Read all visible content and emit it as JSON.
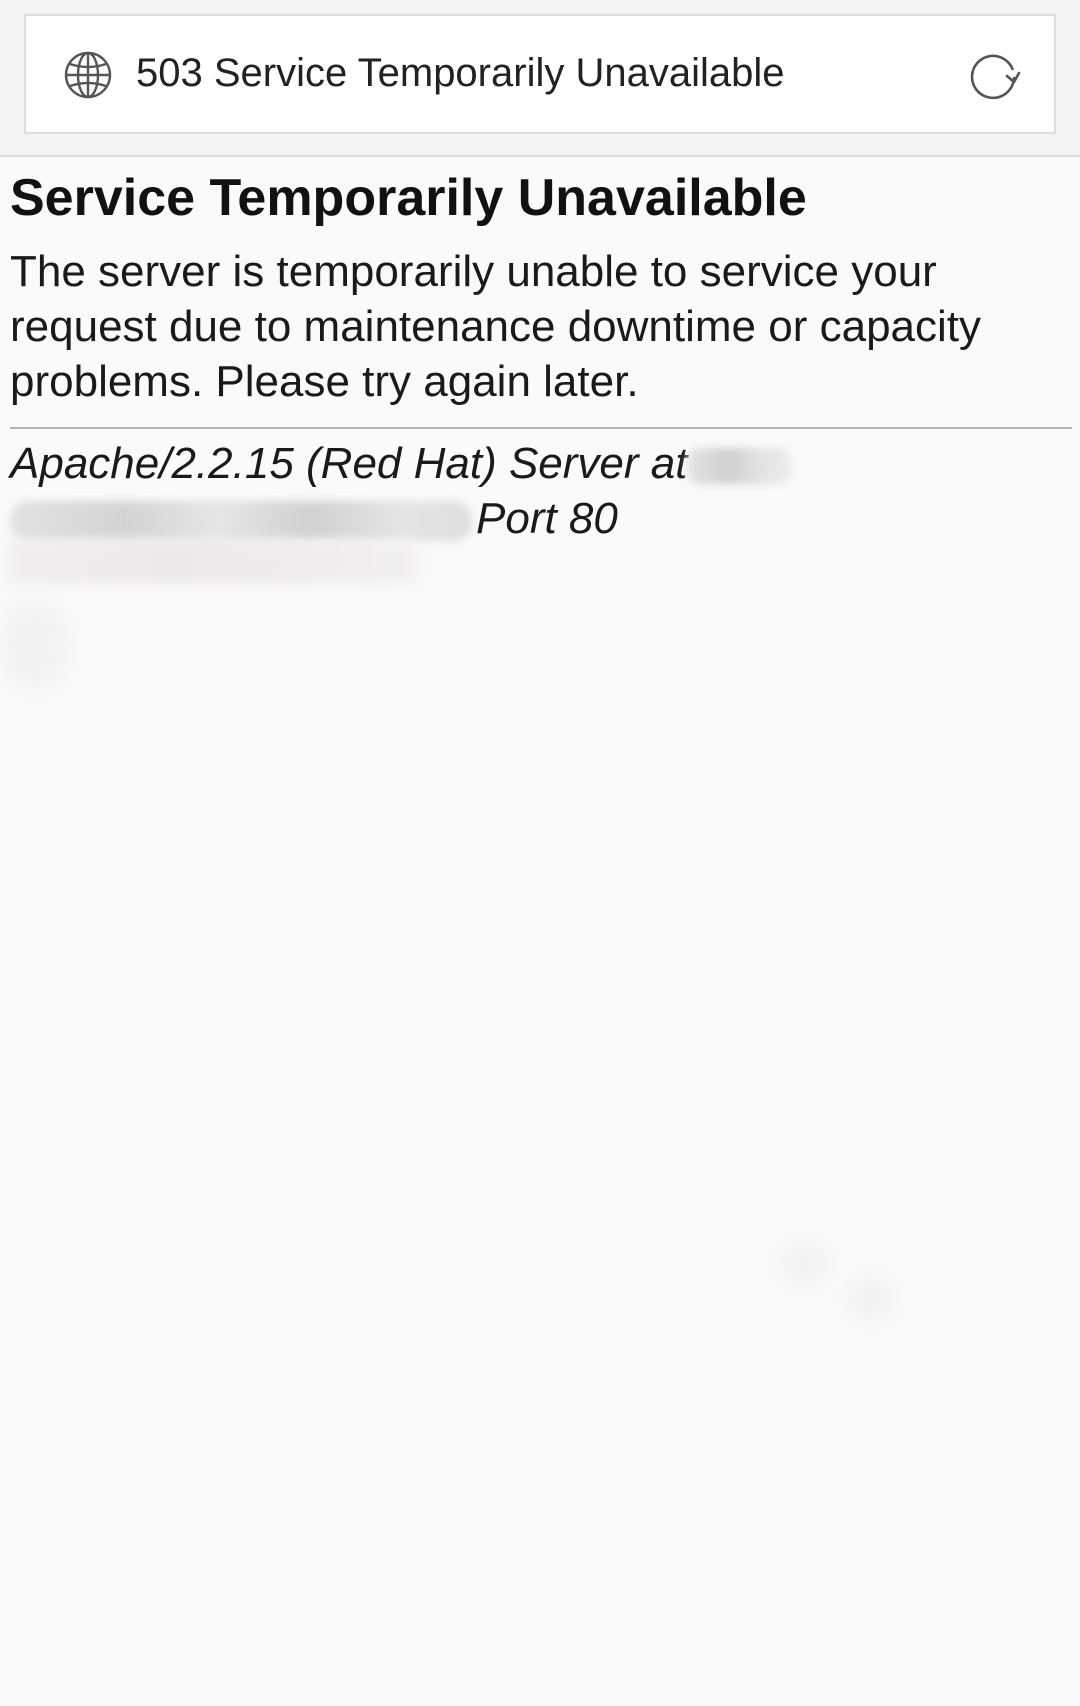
{
  "address_bar": {
    "page_title": "503 Service Temporarily Unavailable",
    "left_icon": "globe-icon",
    "right_icon": "reload-icon"
  },
  "page": {
    "heading": "Service Temporarily Unavailable",
    "message": "The server is temporarily unable to service your request due to maintenance downtime or capacity problems. Please try again later.",
    "signature_prefix": "Apache/2.2.15 (Red Hat) Server at",
    "signature_suffix": "Port 80"
  },
  "colors": {
    "page_background": "#fafafa",
    "toolbar_background": "#f3f3f3",
    "text": "#111111",
    "divider": "#b4b4b4"
  }
}
